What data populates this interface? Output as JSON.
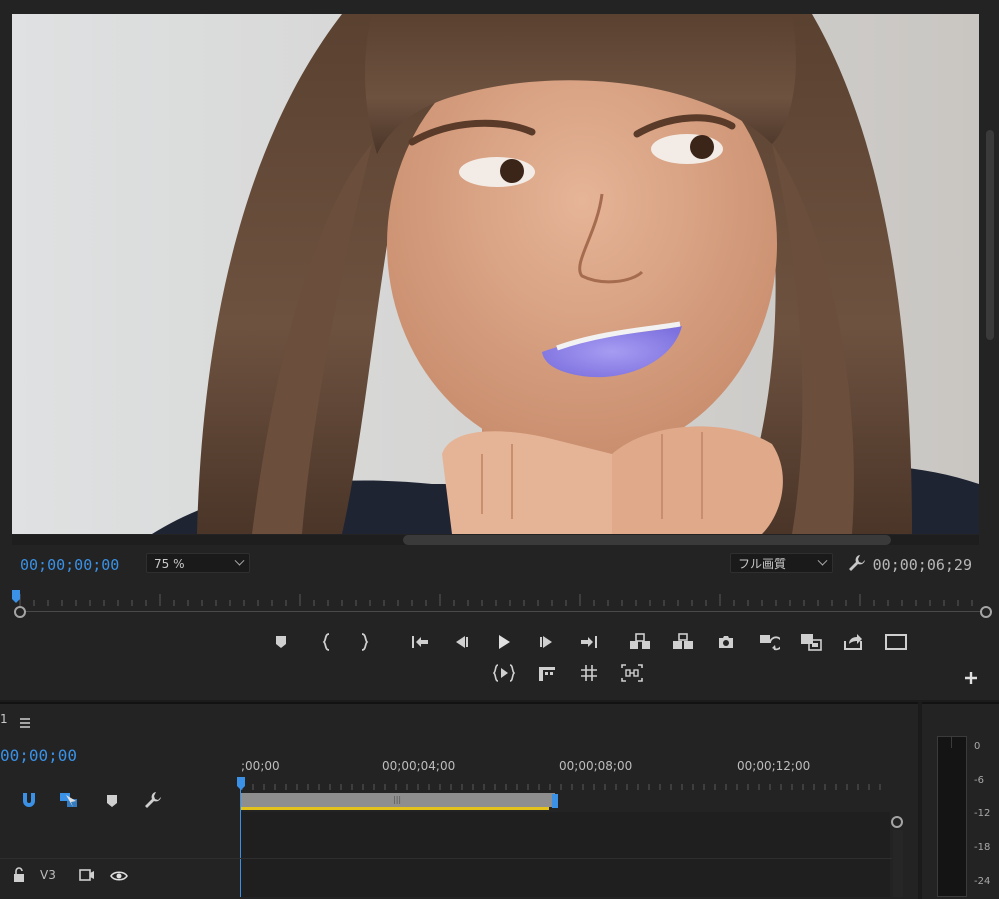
{
  "monitor": {
    "current_timecode": "00;00;00;00",
    "duration_timecode": "00;00;06;29",
    "zoom_value": "75 %",
    "quality_value": "フル画質"
  },
  "timeline": {
    "sequence_number": "1",
    "current_timecode": "00;00;00",
    "ruler_labels": [
      ";00;00",
      "00;00;04;00",
      "00;00;08;00",
      "00;00;12;00"
    ],
    "track_v3": "V3"
  },
  "audio_meter": {
    "scale": [
      "0",
      "-6",
      "-12",
      "-18",
      "-24"
    ]
  },
  "colors": {
    "accent_blue": "#3a91e6",
    "work_area_yellow": "#e3c21b",
    "lip_color": "#8f86e8"
  },
  "icons": {
    "transport": [
      "add-marker-icon",
      "mark-in-icon",
      "mark-out-icon",
      "go-to-in-icon",
      "step-back-icon",
      "play-icon",
      "step-forward-icon",
      "go-to-out-icon",
      "lift-icon",
      "extract-icon",
      "export-frame-icon",
      "insert-icon",
      "overwrite-icon",
      "export-icon",
      "safe-margins-icon"
    ],
    "transport_row2": [
      "play-in-to-out-icon",
      "loop-icon",
      "grid-icon",
      "comparison-view-icon"
    ]
  }
}
